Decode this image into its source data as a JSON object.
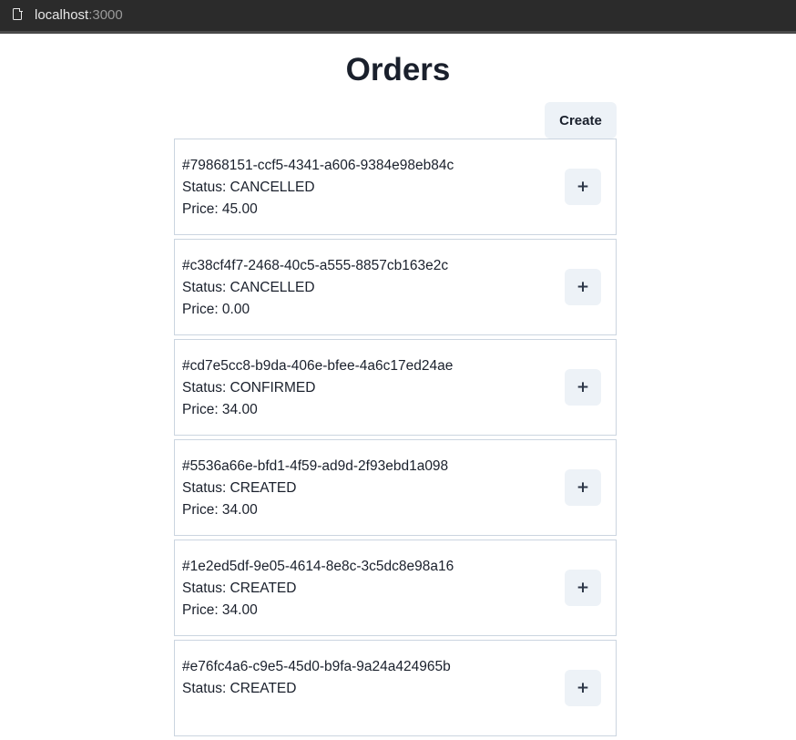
{
  "browser": {
    "host": "localhost",
    "port": ":3000"
  },
  "page": {
    "title": "Orders",
    "create_label": "Create"
  },
  "orders": [
    {
      "id": "#79868151-ccf5-4341-a606-9384e98eb84c",
      "status": "Status: CANCELLED",
      "price": "Price: 45.00",
      "expand_icon": "+"
    },
    {
      "id": "#c38cf4f7-2468-40c5-a555-8857cb163e2c",
      "status": "Status: CANCELLED",
      "price": "Price: 0.00",
      "expand_icon": "+"
    },
    {
      "id": "#cd7e5cc8-b9da-406e-bfee-4a6c17ed24ae",
      "status": "Status: CONFIRMED",
      "price": "Price: 34.00",
      "expand_icon": "+"
    },
    {
      "id": "#5536a66e-bfd1-4f59-ad9d-2f93ebd1a098",
      "status": "Status: CREATED",
      "price": "Price: 34.00",
      "expand_icon": "+"
    },
    {
      "id": "#1e2ed5df-9e05-4614-8e8c-3c5dc8e98a16",
      "status": "Status: CREATED",
      "price": "Price: 34.00",
      "expand_icon": "+"
    },
    {
      "id": "#e76fc4a6-c9e5-45d0-b9fa-9a24a424965b",
      "status": "Status: CREATED",
      "price": "",
      "expand_icon": "+"
    }
  ],
  "colors": {
    "button_bg": "#edf2f7",
    "text": "#1a202c",
    "card_border": "#cbd5e0"
  }
}
